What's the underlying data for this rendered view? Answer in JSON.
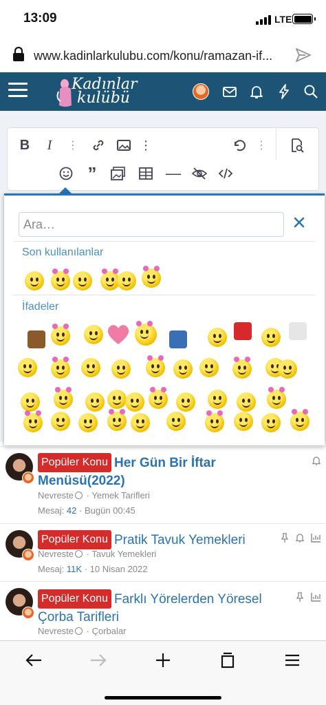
{
  "status_bar": {
    "time": "13:09",
    "network": "LTE"
  },
  "browser": {
    "url": "www.kadinlarkulubu.com/konu/ramazan-if..."
  },
  "site": {
    "logo_line1": "Kadınlar",
    "logo_line2": "kulübü"
  },
  "emoji_picker": {
    "search_placeholder": "Ara…",
    "recent_title": "Son kullanılanlar",
    "expressions_title": "İfadeler"
  },
  "threads": [
    {
      "badge": "Popüler Konu",
      "title": "Her Gün Bir İftar Menüsü(2022)",
      "author": "Nevreste",
      "forum": "Yemek Tarifleri",
      "messages_label": "Mesaj:",
      "messages": "42",
      "date": "Bugün 00:45"
    },
    {
      "badge": "Popüler Konu",
      "title": "Pratik Tavuk Yemekleri",
      "author": "Nevreste",
      "forum": "Tavuk Yemekleri",
      "messages_label": "Mesaj:",
      "messages": "11K",
      "date": "10 Nisan 2022"
    },
    {
      "badge": "Popüler Konu",
      "title": "Farklı Yörelerden Yöresel Çorba Tarifleri",
      "author": "Nevreste",
      "forum": "Çorbalar"
    }
  ],
  "colors": {
    "header": "#1d5375",
    "accent": "#2577b1",
    "badge_red": "#d42b2b",
    "link": "#2a73b0"
  },
  "icons": [
    "lock-icon",
    "share-icon",
    "menu-icon",
    "mail-icon",
    "bell-icon",
    "bolt-icon",
    "search-icon",
    "back-icon",
    "forward-icon",
    "plus-icon",
    "tabs-icon",
    "menu-lines-icon"
  ]
}
